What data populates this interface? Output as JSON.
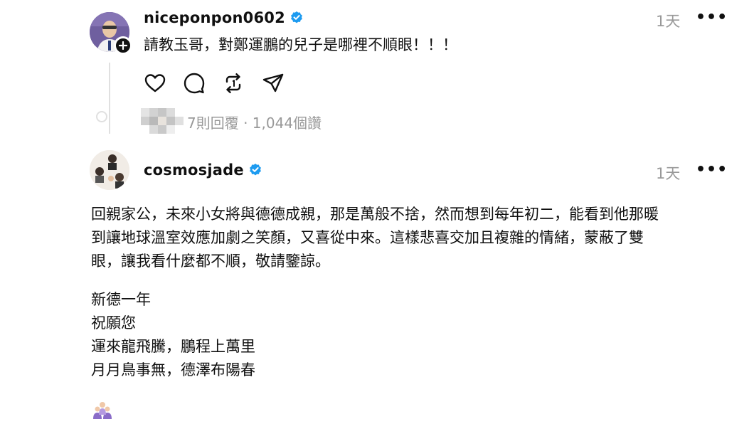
{
  "post1": {
    "username": "niceponpon0602",
    "time": "1天",
    "more": "•••",
    "text": "請教玉哥，對鄭運鵬的兒子是哪裡不順眼！！！",
    "replies_meta": "7則回覆 · 1,044個讚"
  },
  "post2": {
    "username": "cosmosjade",
    "time": "1天",
    "more": "•••",
    "paragraph_lines": [
      "回親家公，未來小女將與德德成親，那是萬般不捨，然而想到每年初二，能看到他那暖",
      "到讓地球溫室效應加劇之笑顏，又喜從中來。這樣悲喜交加且複雜的情緒，蒙蔽了雙",
      "眼，讓我看什麼都不順，敬請鑒諒。"
    ],
    "poem_lines": [
      "新德一年",
      "祝願您",
      "運來龍飛騰，鵬程上萬里",
      "月月鳥事無，德澤布陽春"
    ]
  },
  "colors": {
    "verified": "#1d9bf0",
    "muted": "#999999",
    "text": "#101010",
    "emoji": "#8a6cc8"
  },
  "icons": [
    "heart-icon",
    "comment-icon",
    "repost-icon",
    "share-icon",
    "verified-icon",
    "more-icon",
    "follow-plus-icon"
  ]
}
